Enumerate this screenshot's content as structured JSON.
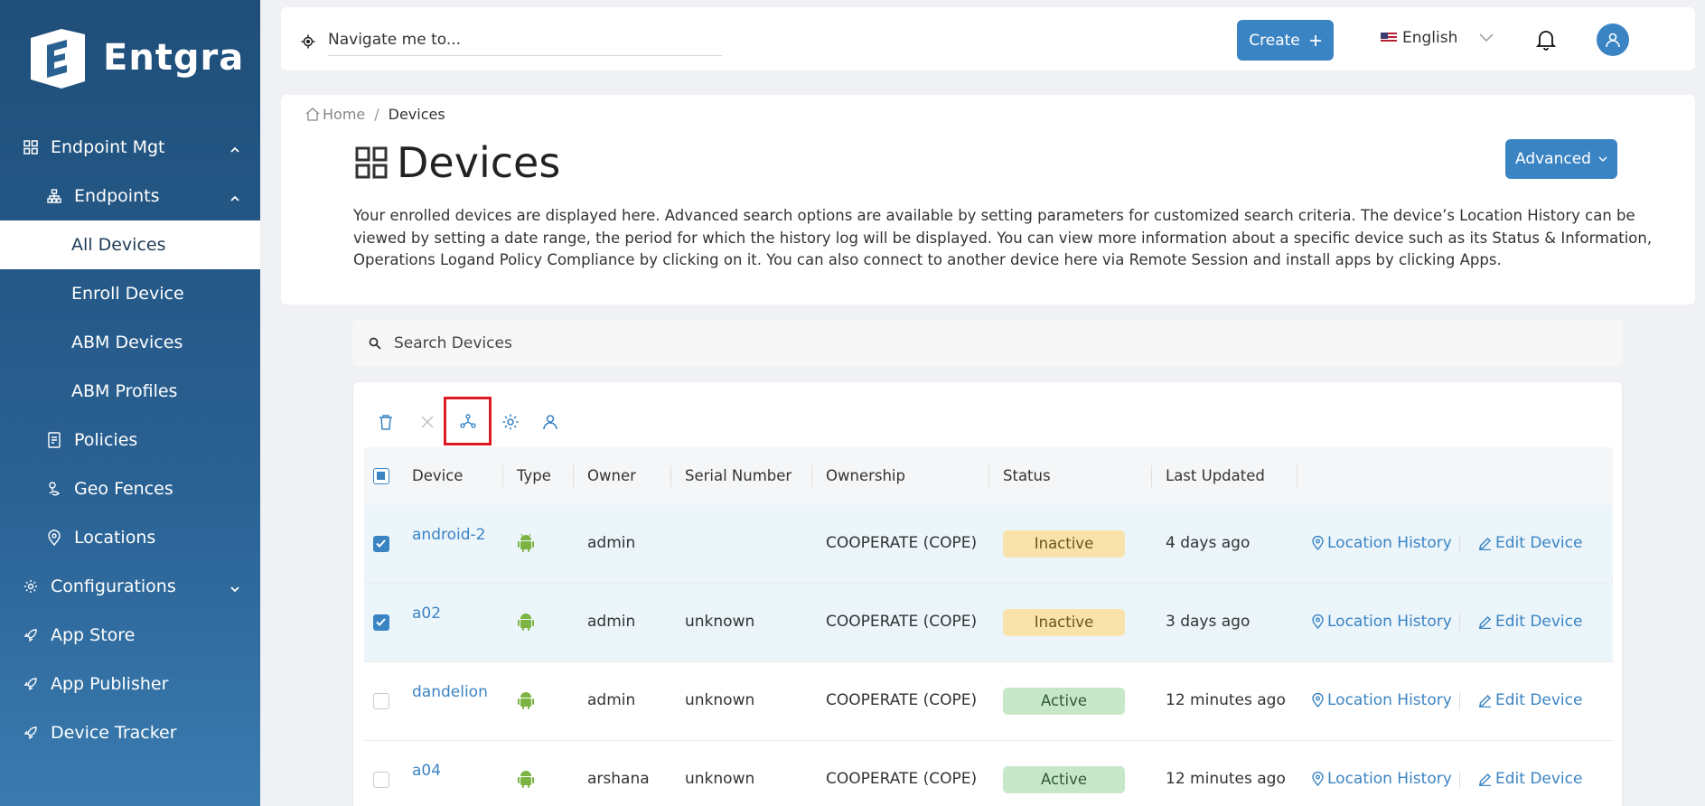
{
  "brand": {
    "name": "Entgra"
  },
  "sidebar": {
    "items": [
      {
        "label": "Endpoint Mgt",
        "icon": "grid-icon",
        "expanded": true
      },
      {
        "label": "Endpoints",
        "icon": "sitemap-icon",
        "expanded": true
      },
      {
        "label": "All Devices",
        "active": true
      },
      {
        "label": "Enroll Device"
      },
      {
        "label": "ABM Devices"
      },
      {
        "label": "ABM Profiles"
      },
      {
        "label": "Policies",
        "icon": "policy-icon"
      },
      {
        "label": "Geo Fences",
        "icon": "geofence-icon"
      },
      {
        "label": "Locations",
        "icon": "location-pin-icon"
      },
      {
        "label": "Configurations",
        "icon": "gear-icon",
        "expanded": false
      },
      {
        "label": "App Store",
        "icon": "rocket-icon"
      },
      {
        "label": "App Publisher",
        "icon": "rocket-icon"
      },
      {
        "label": "Device Tracker",
        "icon": "rocket-icon"
      }
    ]
  },
  "topbar": {
    "search_placeholder": "Navigate me to...",
    "create_label": "Create",
    "language": "English"
  },
  "header": {
    "breadcrumb_home": "Home",
    "breadcrumb_sep": "/",
    "breadcrumb_current": "Devices",
    "title": "Devices",
    "advanced_label": "Advanced",
    "description": "Your enrolled devices are displayed here. Advanced search options are available by setting parameters for customized search criteria. The device’s Location History can be viewed by setting a date range, the period for which the history log will be displayed. You can view more information about a specific device such as its Status & Information, Operations Logand Policy Compliance by clicking on it. You can also connect to another device here via Remote Session and install apps by clicking Apps."
  },
  "search": {
    "placeholder": "Search Devices"
  },
  "toolbar": {
    "icons": [
      "trash-icon",
      "close-icon",
      "group-icon",
      "gear-icon",
      "user-icon"
    ],
    "highlighted": "group-icon"
  },
  "table": {
    "columns": [
      "Device",
      "Type",
      "Owner",
      "Serial Number",
      "Ownership",
      "Status",
      "Last Updated"
    ],
    "rows": [
      {
        "device": "android-2",
        "owner": "admin",
        "serial": "",
        "ownership": "COOPERATE (COPE)",
        "status": "Inactive",
        "updated": "4 days ago",
        "selected": true
      },
      {
        "device": "a02",
        "owner": "admin",
        "serial": "unknown",
        "ownership": "COOPERATE (COPE)",
        "status": "Inactive",
        "updated": "3 days ago",
        "selected": true
      },
      {
        "device": "dandelion",
        "owner": "admin",
        "serial": "unknown",
        "ownership": "COOPERATE (COPE)",
        "status": "Active",
        "updated": "12 minutes ago",
        "selected": false
      },
      {
        "device": "a04",
        "owner": "arshana",
        "serial": "unknown",
        "ownership": "COOPERATE (COPE)",
        "status": "Active",
        "updated": "12 minutes ago",
        "selected": false
      }
    ],
    "actions": {
      "location_history": "Location History",
      "edit_device": "Edit Device"
    }
  },
  "colors": {
    "accent": "#3b84c4",
    "sidebar": "#1f4e79",
    "android": "#7cb342",
    "highlight": "#e01a22"
  }
}
